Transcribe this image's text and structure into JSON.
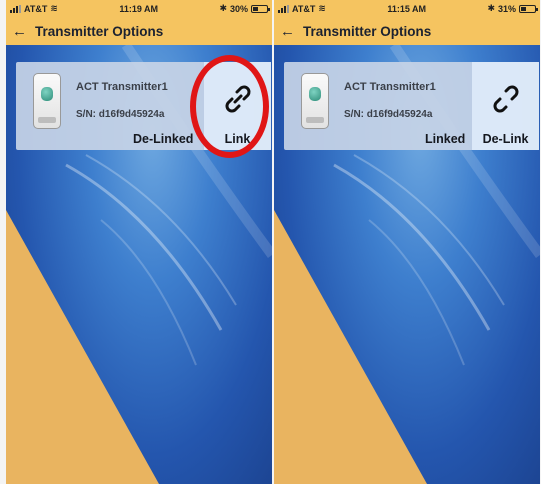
{
  "screens": [
    {
      "status": {
        "carrier": "AT&T",
        "time": "11:19 AM",
        "battery_pct": "30%",
        "battery_level": 0.3
      },
      "title": "Transmitter Options",
      "device": {
        "name": "ACT Transmitter1",
        "serial": "S/N: d16f9d45924a",
        "status": "De-Linked",
        "action_label": "Link",
        "action_icon": "link-icon"
      }
    },
    {
      "status": {
        "carrier": "AT&T",
        "time": "11:15 AM",
        "battery_pct": "31%",
        "battery_level": 0.31
      },
      "title": "Transmitter Options",
      "device": {
        "name": "ACT Transmitter1",
        "serial": "S/N: d16f9d45924a",
        "status": "Linked",
        "action_label": "De-Link",
        "action_icon": "broken-link-icon"
      }
    }
  ],
  "colors": {
    "header_bg": "#f5c460",
    "highlight": "#e01616",
    "text_dark": "#15181f"
  }
}
